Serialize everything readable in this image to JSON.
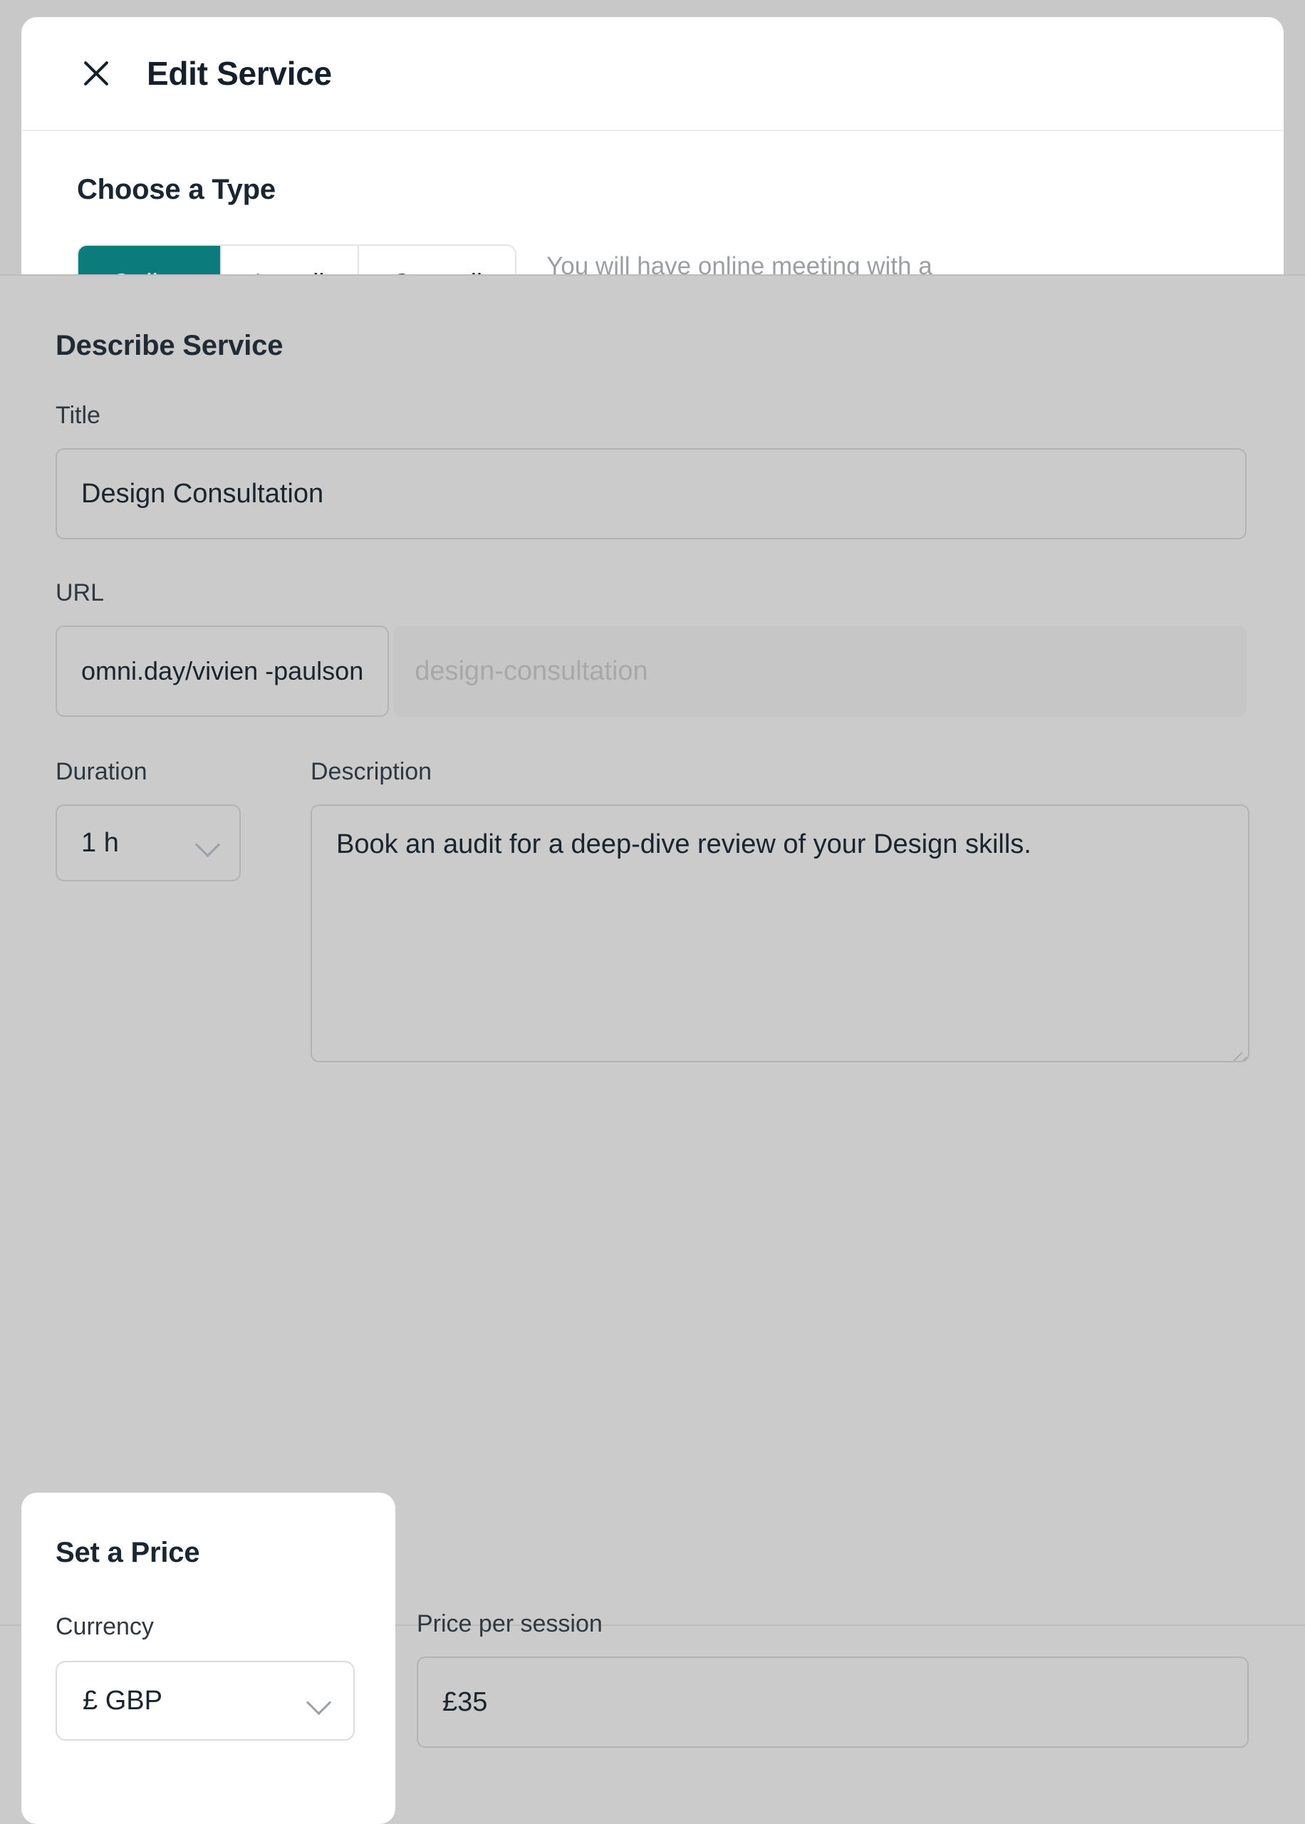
{
  "header": {
    "title": "Edit Service",
    "close_icon": "close-icon"
  },
  "type_section": {
    "heading": "Choose a Type",
    "options": [
      {
        "label": "Online",
        "active": true
      },
      {
        "label": "In-call",
        "active": false
      },
      {
        "label": "Out-call",
        "active": false
      }
    ],
    "hint": "You will have online meeting with a client",
    "active_color": "#0c7b7b"
  },
  "describe_section": {
    "heading": "Describe Service",
    "title_label": "Title",
    "title_value": "Design Consultation",
    "url_label": "URL",
    "url_prefix": "omni.day/vivien -paulson",
    "url_placeholder": "design-consultation",
    "duration_label": "Duration",
    "duration_value": "1 h",
    "description_label": "Description",
    "description_value": "Book an audit for a deep-dive review of your Design skills."
  },
  "price_section": {
    "heading": "Set a Price",
    "currency_label": "Currency",
    "currency_value": "£ GBP",
    "price_label": "Price per session",
    "price_value": "£35"
  }
}
